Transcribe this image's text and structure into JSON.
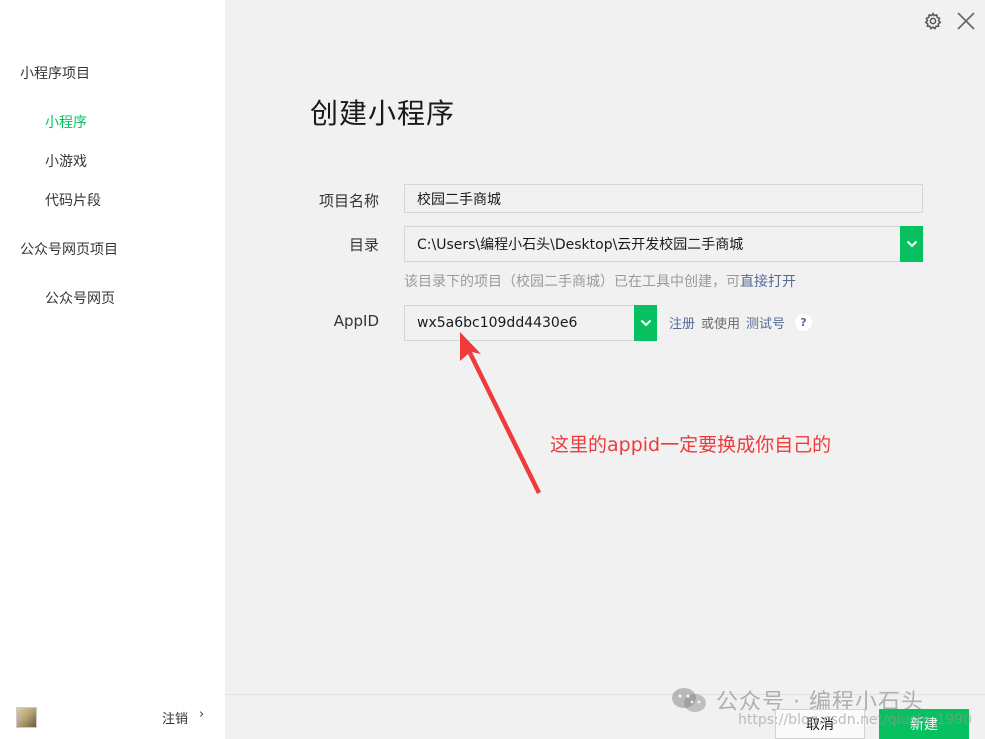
{
  "sidebar": {
    "groups": [
      {
        "label": "小程序项目",
        "items": [
          {
            "label": "小程序",
            "active": true
          },
          {
            "label": "小游戏",
            "active": false
          },
          {
            "label": "代码片段",
            "active": false
          }
        ]
      },
      {
        "label": "公众号网页项目",
        "items": [
          {
            "label": "公众号网页",
            "active": false
          }
        ]
      }
    ],
    "footer": {
      "logout_label": "注销",
      "chevron": "›"
    }
  },
  "header": {
    "settings_icon": "gear-icon",
    "close_icon": "close-icon"
  },
  "main": {
    "title": "创建小程序",
    "form": {
      "project_name": {
        "label": "项目名称",
        "value": "校园二手商城"
      },
      "directory": {
        "label": "目录",
        "value": "C:\\Users\\编程小石头\\Desktop\\云开发校园二手商城",
        "hint_prefix": "该目录下的项目（校园二手商城）已在工具中创建，可",
        "hint_link": "直接打开"
      },
      "appid": {
        "label": "AppID",
        "value": "wx5a6bc109dd4430e6",
        "register_link": "注册",
        "or_use": "或使用",
        "test_link": "测试号",
        "help": "?"
      }
    },
    "annotation": {
      "text": "这里的appid一定要换成你自己的",
      "color": "#ef3b3b"
    }
  },
  "actions": {
    "cancel_label": "取消",
    "create_label": "新建"
  },
  "watermark": {
    "main": "公众号 · 编程小石头",
    "url": "https://blog.csdn.net/qiushi_1990"
  },
  "colors": {
    "accent": "#07c160",
    "link": "#576b95",
    "annotation": "#ef3b3b"
  }
}
